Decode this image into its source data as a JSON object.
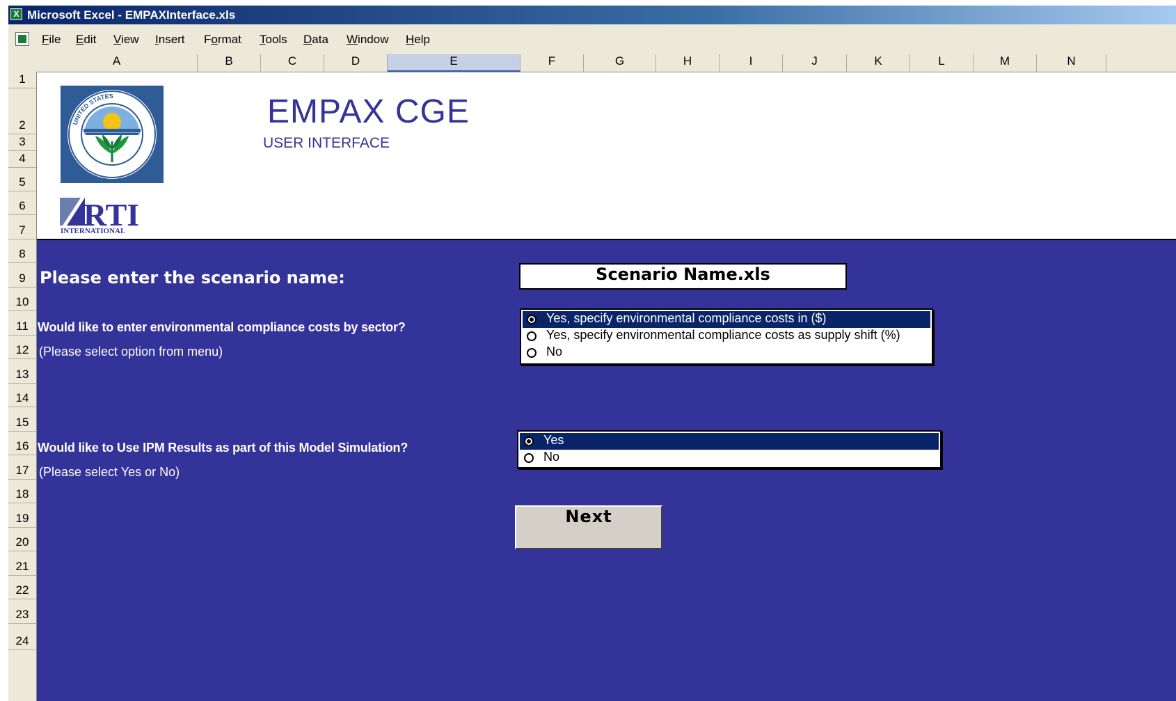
{
  "window": {
    "title": "Microsoft Excel - EMPAXInterface.xls"
  },
  "menu": [
    {
      "pre": "",
      "u": "F",
      "post": "ile"
    },
    {
      "pre": "",
      "u": "E",
      "post": "dit"
    },
    {
      "pre": "",
      "u": "V",
      "post": "iew"
    },
    {
      "pre": "",
      "u": "I",
      "post": "nsert"
    },
    {
      "pre": "F",
      "u": "o",
      "post": "rmat"
    },
    {
      "pre": "",
      "u": "T",
      "post": "ools"
    },
    {
      "pre": "",
      "u": "D",
      "post": "ata"
    },
    {
      "pre": "",
      "u": "W",
      "post": "indow"
    },
    {
      "pre": "",
      "u": "H",
      "post": "elp"
    }
  ],
  "columns": [
    "A",
    "B",
    "C",
    "D",
    "E",
    "F",
    "G",
    "H",
    "I",
    "J",
    "K",
    "L",
    "M",
    "N"
  ],
  "selected_column": "E",
  "rows": [
    "1",
    "2",
    "3",
    "4",
    "5",
    "6",
    "7",
    "8",
    "9",
    "10",
    "11",
    "12",
    "13",
    "14",
    "15",
    "16",
    "17",
    "18",
    "19",
    "20",
    "21",
    "22",
    "23",
    "24"
  ],
  "header": {
    "title": "EMPAX CGE",
    "subtitle": "USER INTERFACE",
    "rti_text": "RTI",
    "rti_sub": "INTERNATIONAL",
    "seal_text": "UNITED STATES ENVIRONMENTAL PROTECTION AGENCY"
  },
  "form": {
    "scenario_prompt": "Please enter the scenario name:",
    "scenario_value": "Scenario Name.xls",
    "q1": "Would like to enter environmental compliance costs by sector?",
    "q1_hint": "(Please select option from menu)",
    "q1_options": [
      "Yes, specify environmental compliance costs in ($)",
      "Yes, specify environmental compliance costs as supply shift (%)",
      "No"
    ],
    "q1_selected": 0,
    "q2": "Would like to Use IPM Results as part of this Model Simulation?",
    "q2_hint": "(Please select Yes or No)",
    "q2_options": [
      "Yes",
      "No"
    ],
    "q2_selected": 0,
    "next_label": "Next"
  },
  "colors": {
    "sheet_blue": "#333399",
    "selection": "#0a246a"
  }
}
